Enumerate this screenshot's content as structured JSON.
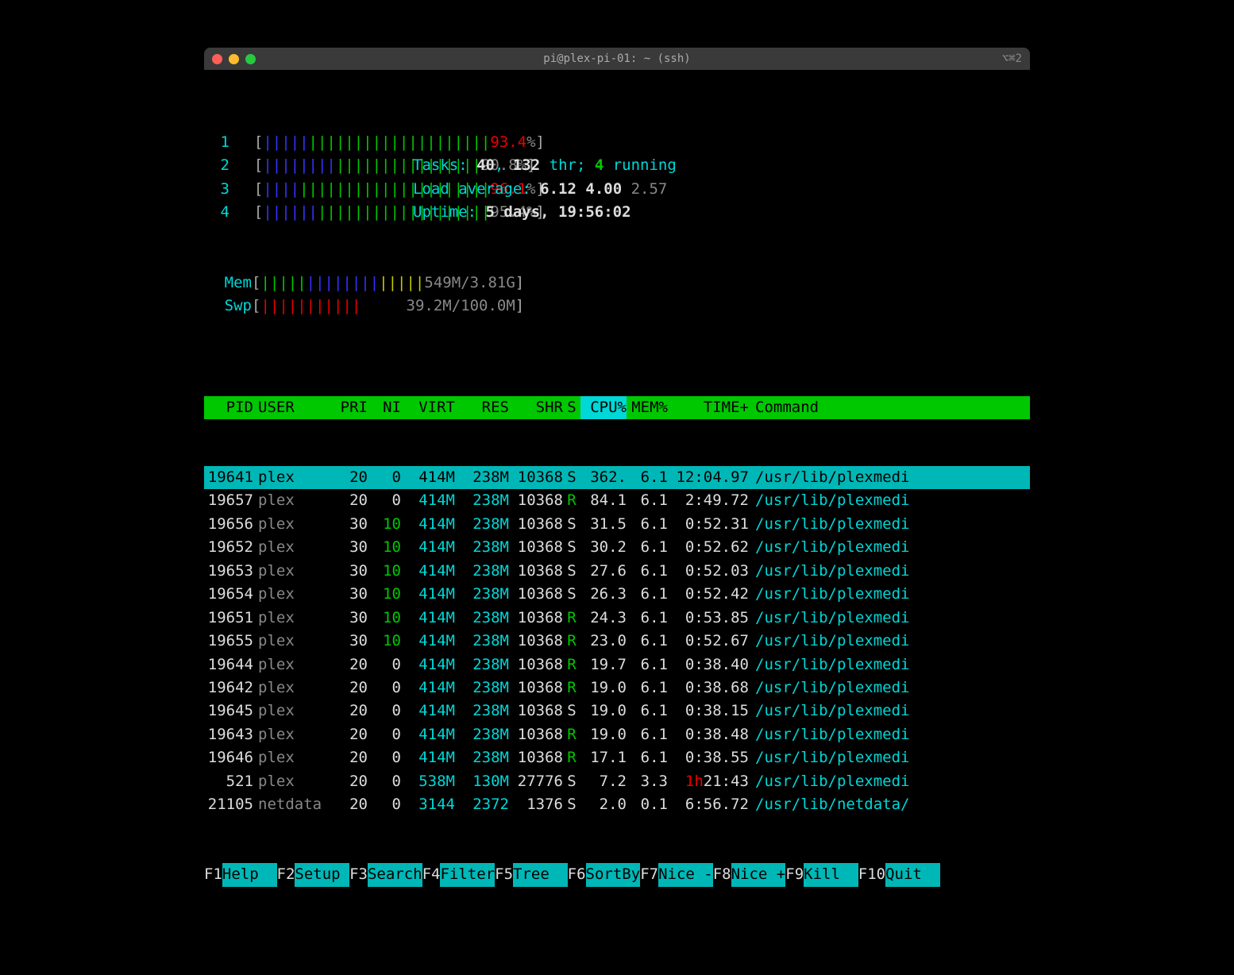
{
  "window": {
    "title": "pi@plex-pi-01: ~ (ssh)",
    "shortcut": "⌥⌘2"
  },
  "cpu_meters": [
    {
      "n": "1",
      "bars_blue": "|||||",
      "bars_green": "||||||||||||||||||||",
      "pct": "93.4",
      "pct_class": "red"
    },
    {
      "n": "2",
      "bars_blue": "||||||||",
      "bars_green": "||||||||||||||||",
      "pct": "90.8",
      "pct_class": "gray"
    },
    {
      "n": "3",
      "bars_blue": "||||",
      "bars_green": "|||||||||||||||||||||",
      "pct": "96.1",
      "pct_class": "red"
    },
    {
      "n": "4",
      "bars_blue": "||||||",
      "bars_green": "|||||||||||||||||||",
      "pct": "95.4",
      "pct_class": "gray"
    }
  ],
  "mem": {
    "label": "Mem",
    "bars_green": "|||||",
    "bars_blue": "||||||||",
    "bars_yellow": "|||||",
    "text": "549M/3.81G"
  },
  "swp": {
    "label": "Swp",
    "bars_red": "|||||||||||",
    "text": "39.2M/100.0M"
  },
  "tasks": {
    "label": "Tasks: ",
    "total": "40",
    "sep": ", ",
    "thr": "132",
    "thr_label": " thr; ",
    "running": "4",
    "run_label": " running"
  },
  "load": {
    "label": "Load average: ",
    "v1": "6.12",
    "v2": "4.00",
    "v3": "2.57"
  },
  "uptime": {
    "label": "Uptime: ",
    "value": "5 days, 19:56:02"
  },
  "headers": {
    "pid": "PID",
    "user": "USER",
    "pri": "PRI",
    "ni": "NI",
    "virt": "VIRT",
    "res": "RES",
    "shr": "SHR",
    "s": "S",
    "cpu": "CPU%",
    "mem": "MEM%",
    "time": "TIME+",
    "cmd": "Command"
  },
  "procs": [
    {
      "pid": "19641",
      "user": "plex",
      "pri": "20",
      "ni": "0",
      "virt": "414M",
      "res": "238M",
      "shr": "10368",
      "s": "S",
      "cpu": "362.",
      "mem": "6.1",
      "time": "12:04.97",
      "cmd": "/usr/lib/plexmedi",
      "selected": true,
      "ni_green": false,
      "s_green": false,
      "time_red": ""
    },
    {
      "pid": "19657",
      "user": "plex",
      "pri": "20",
      "ni": "0",
      "virt": "414M",
      "res": "238M",
      "shr": "10368",
      "s": "R",
      "cpu": "84.1",
      "mem": "6.1",
      "time": "2:49.72",
      "cmd": "/usr/lib/plexmedi",
      "selected": false,
      "ni_green": false,
      "s_green": true,
      "time_red": ""
    },
    {
      "pid": "19656",
      "user": "plex",
      "pri": "30",
      "ni": "10",
      "virt": "414M",
      "res": "238M",
      "shr": "10368",
      "s": "S",
      "cpu": "31.5",
      "mem": "6.1",
      "time": "0:52.31",
      "cmd": "/usr/lib/plexmedi",
      "selected": false,
      "ni_green": true,
      "s_green": false,
      "time_red": ""
    },
    {
      "pid": "19652",
      "user": "plex",
      "pri": "30",
      "ni": "10",
      "virt": "414M",
      "res": "238M",
      "shr": "10368",
      "s": "S",
      "cpu": "30.2",
      "mem": "6.1",
      "time": "0:52.62",
      "cmd": "/usr/lib/plexmedi",
      "selected": false,
      "ni_green": true,
      "s_green": false,
      "time_red": ""
    },
    {
      "pid": "19653",
      "user": "plex",
      "pri": "30",
      "ni": "10",
      "virt": "414M",
      "res": "238M",
      "shr": "10368",
      "s": "S",
      "cpu": "27.6",
      "mem": "6.1",
      "time": "0:52.03",
      "cmd": "/usr/lib/plexmedi",
      "selected": false,
      "ni_green": true,
      "s_green": false,
      "time_red": ""
    },
    {
      "pid": "19654",
      "user": "plex",
      "pri": "30",
      "ni": "10",
      "virt": "414M",
      "res": "238M",
      "shr": "10368",
      "s": "S",
      "cpu": "26.3",
      "mem": "6.1",
      "time": "0:52.42",
      "cmd": "/usr/lib/plexmedi",
      "selected": false,
      "ni_green": true,
      "s_green": false,
      "time_red": ""
    },
    {
      "pid": "19651",
      "user": "plex",
      "pri": "30",
      "ni": "10",
      "virt": "414M",
      "res": "238M",
      "shr": "10368",
      "s": "R",
      "cpu": "24.3",
      "mem": "6.1",
      "time": "0:53.85",
      "cmd": "/usr/lib/plexmedi",
      "selected": false,
      "ni_green": true,
      "s_green": true,
      "time_red": ""
    },
    {
      "pid": "19655",
      "user": "plex",
      "pri": "30",
      "ni": "10",
      "virt": "414M",
      "res": "238M",
      "shr": "10368",
      "s": "R",
      "cpu": "23.0",
      "mem": "6.1",
      "time": "0:52.67",
      "cmd": "/usr/lib/plexmedi",
      "selected": false,
      "ni_green": true,
      "s_green": true,
      "time_red": ""
    },
    {
      "pid": "19644",
      "user": "plex",
      "pri": "20",
      "ni": "0",
      "virt": "414M",
      "res": "238M",
      "shr": "10368",
      "s": "R",
      "cpu": "19.7",
      "mem": "6.1",
      "time": "0:38.40",
      "cmd": "/usr/lib/plexmedi",
      "selected": false,
      "ni_green": false,
      "s_green": true,
      "time_red": ""
    },
    {
      "pid": "19642",
      "user": "plex",
      "pri": "20",
      "ni": "0",
      "virt": "414M",
      "res": "238M",
      "shr": "10368",
      "s": "R",
      "cpu": "19.0",
      "mem": "6.1",
      "time": "0:38.68",
      "cmd": "/usr/lib/plexmedi",
      "selected": false,
      "ni_green": false,
      "s_green": true,
      "time_red": ""
    },
    {
      "pid": "19645",
      "user": "plex",
      "pri": "20",
      "ni": "0",
      "virt": "414M",
      "res": "238M",
      "shr": "10368",
      "s": "S",
      "cpu": "19.0",
      "mem": "6.1",
      "time": "0:38.15",
      "cmd": "/usr/lib/plexmedi",
      "selected": false,
      "ni_green": false,
      "s_green": false,
      "time_red": ""
    },
    {
      "pid": "19643",
      "user": "plex",
      "pri": "20",
      "ni": "0",
      "virt": "414M",
      "res": "238M",
      "shr": "10368",
      "s": "R",
      "cpu": "19.0",
      "mem": "6.1",
      "time": "0:38.48",
      "cmd": "/usr/lib/plexmedi",
      "selected": false,
      "ni_green": false,
      "s_green": true,
      "time_red": ""
    },
    {
      "pid": "19646",
      "user": "plex",
      "pri": "20",
      "ni": "0",
      "virt": "414M",
      "res": "238M",
      "shr": "10368",
      "s": "R",
      "cpu": "17.1",
      "mem": "6.1",
      "time": "0:38.55",
      "cmd": "/usr/lib/plexmedi",
      "selected": false,
      "ni_green": false,
      "s_green": true,
      "time_red": ""
    },
    {
      "pid": "521",
      "user": "plex",
      "pri": "20",
      "ni": "0",
      "virt": "538M",
      "res": "130M",
      "shr": "27776",
      "s": "S",
      "cpu": "7.2",
      "mem": "3.3",
      "time": "21:43",
      "cmd": "/usr/lib/plexmedi",
      "selected": false,
      "ni_green": false,
      "s_green": false,
      "time_red": "1h"
    },
    {
      "pid": "21105",
      "user": "netdata",
      "pri": "20",
      "ni": "0",
      "virt": "3144",
      "res": "2372",
      "shr": "1376",
      "s": "S",
      "cpu": "2.0",
      "mem": "0.1",
      "time": "6:56.72",
      "cmd": "/usr/lib/netdata/",
      "selected": false,
      "ni_green": false,
      "s_green": false,
      "time_red": ""
    }
  ],
  "footer": [
    {
      "key": "F1",
      "label": "Help  "
    },
    {
      "key": "F2",
      "label": "Setup "
    },
    {
      "key": "F3",
      "label": "Search"
    },
    {
      "key": "F4",
      "label": "Filter"
    },
    {
      "key": "F5",
      "label": "Tree  "
    },
    {
      "key": "F6",
      "label": "SortBy"
    },
    {
      "key": "F7",
      "label": "Nice -"
    },
    {
      "key": "F8",
      "label": "Nice +"
    },
    {
      "key": "F9",
      "label": "Kill  "
    },
    {
      "key": "F10",
      "label": "Quit  "
    }
  ]
}
